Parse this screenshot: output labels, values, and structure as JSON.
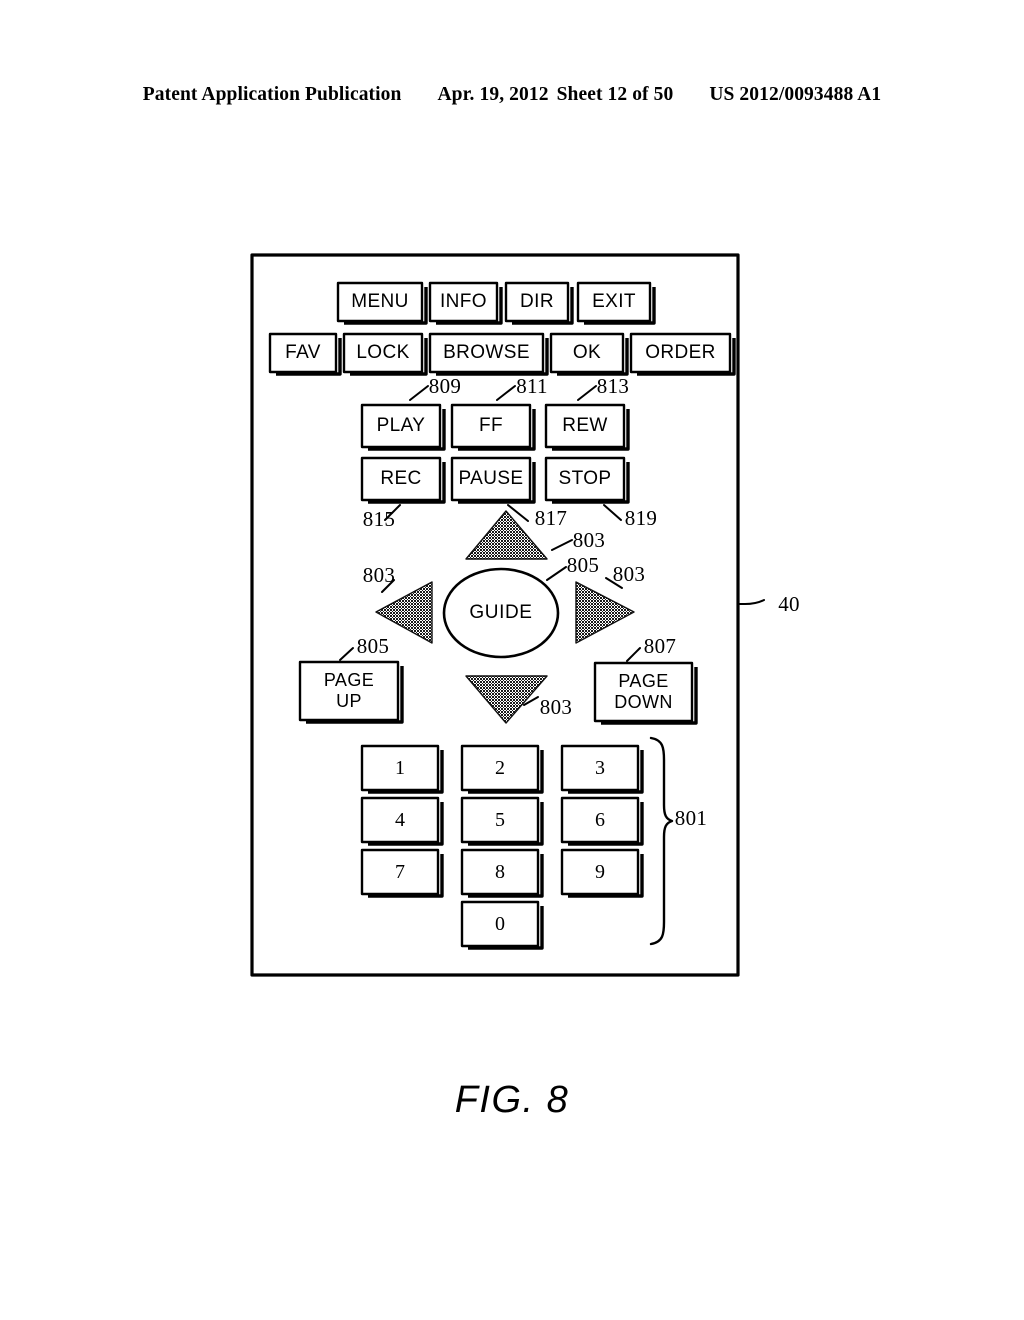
{
  "header": {
    "publication": "Patent Application Publication",
    "date": "Apr. 19, 2012",
    "sheet": "Sheet 12 of 50",
    "number": "US 2012/0093488 A1"
  },
  "figure": {
    "caption": "FIG. 8",
    "device_ref": "40"
  },
  "remote": {
    "row1": [
      {
        "label": "MENU",
        "name": "menu-button"
      },
      {
        "label": "INFO",
        "name": "info-button"
      },
      {
        "label": "DIR",
        "name": "dir-button"
      },
      {
        "label": "EXIT",
        "name": "exit-button"
      }
    ],
    "row2": [
      {
        "label": "FAV",
        "name": "fav-button"
      },
      {
        "label": "LOCK",
        "name": "lock-button"
      },
      {
        "label": "BROWSE",
        "name": "browse-button"
      },
      {
        "label": "OK",
        "name": "ok-button"
      },
      {
        "label": "ORDER",
        "name": "order-button"
      }
    ],
    "transport_row1": [
      {
        "label": "PLAY",
        "name": "play-button",
        "ref": "809"
      },
      {
        "label": "FF",
        "name": "ff-button",
        "ref": "811"
      },
      {
        "label": "REW",
        "name": "rew-button",
        "ref": "813"
      }
    ],
    "transport_row2": [
      {
        "label": "REC",
        "name": "rec-button",
        "ref": "815"
      },
      {
        "label": "PAUSE",
        "name": "pause-button",
        "ref": "817"
      },
      {
        "label": "STOP",
        "name": "stop-button",
        "ref": "819"
      }
    ],
    "dpad": {
      "up": {
        "name": "dpad-up-arrow",
        "ref": "803"
      },
      "down": {
        "name": "dpad-down-arrow",
        "ref": "803"
      },
      "left": {
        "name": "dpad-left-arrow",
        "ref": "803"
      },
      "right": {
        "name": "dpad-right-arrow",
        "ref": "803"
      },
      "center": {
        "label": "GUIDE",
        "name": "guide-button",
        "ref": "805"
      }
    },
    "page_up": {
      "line1": "PAGE",
      "line2": "UP",
      "ref": "805"
    },
    "page_down": {
      "line1": "PAGE",
      "line2": "DOWN",
      "ref": "807"
    },
    "keypad": {
      "ref": "801",
      "rows": [
        [
          "1",
          "2",
          "3"
        ],
        [
          "4",
          "5",
          "6"
        ],
        [
          "7",
          "8",
          "9"
        ]
      ],
      "zero": "0"
    }
  },
  "reference_numerals": {
    "keypad": "801",
    "arrows": "803",
    "guide": "805",
    "page_up": "805",
    "page_down": "807",
    "play": "809",
    "ff": "811",
    "rew": "813",
    "rec": "815",
    "pause": "817",
    "stop": "819",
    "device": "40"
  },
  "colors": {
    "ink": "#000000",
    "paper": "#ffffff",
    "arrow_fill": "#3a3a3a"
  }
}
